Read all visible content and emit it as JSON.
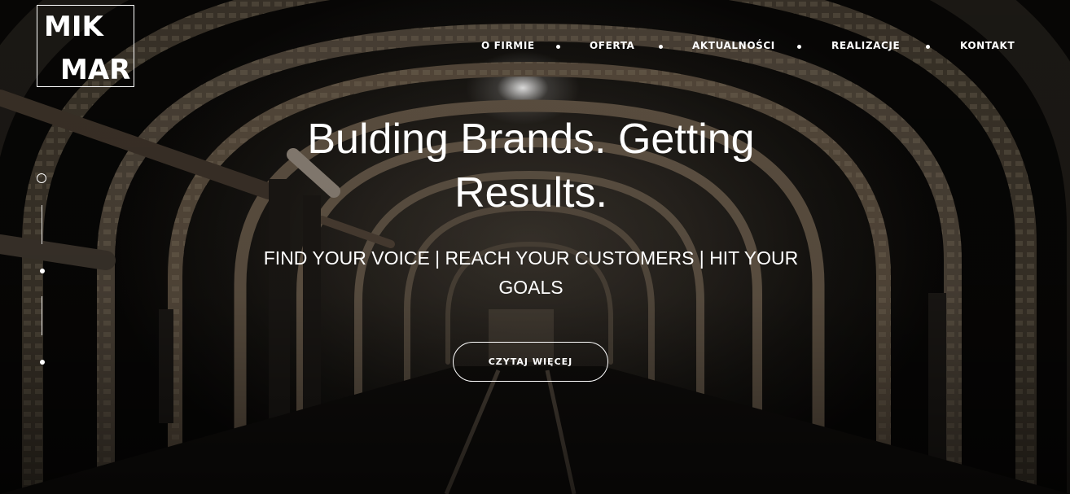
{
  "logo": {
    "line1": "MIK",
    "line2": "MAR"
  },
  "nav": {
    "items": [
      {
        "label": "O FIRMIE"
      },
      {
        "label": "OFERTA"
      },
      {
        "label": "AKTUALNOŚCI"
      },
      {
        "label": "REALIZACJE"
      },
      {
        "label": "KONTAKT"
      }
    ]
  },
  "hero": {
    "headline": "Bulding Brands. Getting Results.",
    "subline": "FIND YOUR VOICE | REACH YOUR CUSTOMERS | HIT YOUR GOALS",
    "cta_label": "CZYTAJ WIĘCEJ"
  }
}
